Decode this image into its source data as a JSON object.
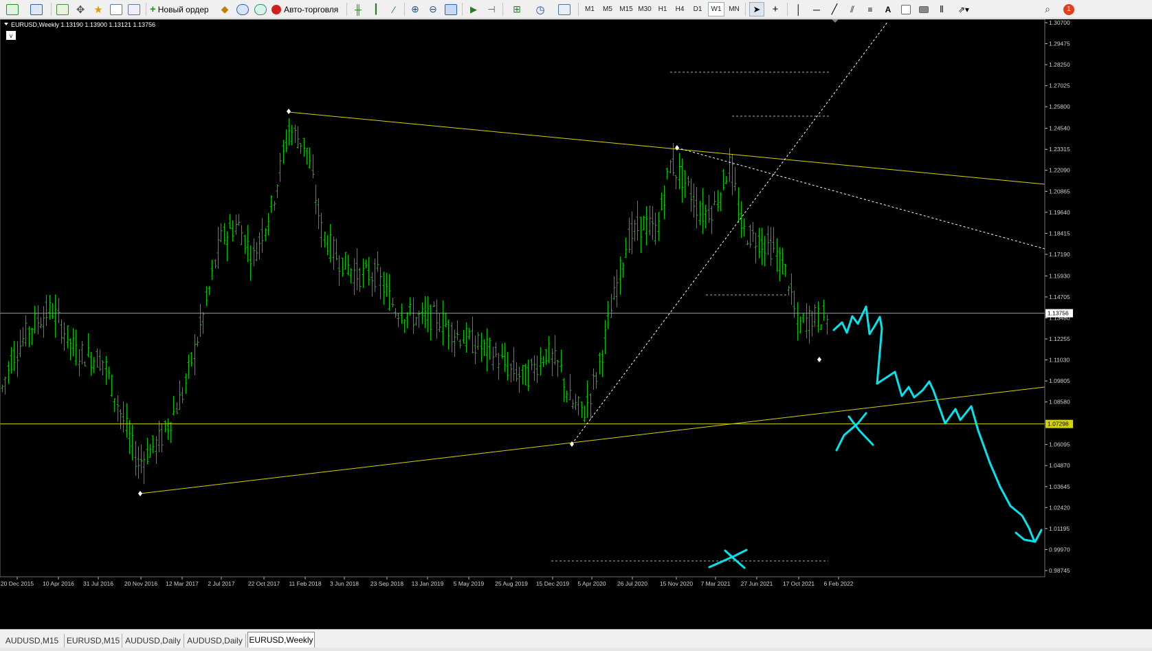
{
  "toolbar": {
    "new_order": "Новый ордер",
    "auto_trading": "Авто-торговля",
    "timeframes": [
      "M1",
      "M5",
      "M15",
      "M30",
      "H1",
      "H4",
      "D1",
      "W1",
      "MN"
    ],
    "active_timeframe": "W1",
    "notification_count": "1"
  },
  "chart": {
    "header": "EURUSD,Weekly  1.13190 1.13900 1.13121 1.13756",
    "collapse_label": "v",
    "bid_label": "1.13756",
    "level_label": "1.07298",
    "background": "#000000",
    "candle_color": "#00c800",
    "line_color": "#d4d400",
    "drawing_color": "#00e5ee"
  },
  "chart_data": {
    "type": "ohlc",
    "symbol": "EURUSD",
    "timeframe": "Weekly",
    "open": 1.1319,
    "high": 1.139,
    "low": 1.13121,
    "close": 1.13756,
    "x_ticks": [
      "20 Dec 2015",
      "10 Apr 2016",
      "31 Jul 2016",
      "20 Nov 2016",
      "12 Mar 2017",
      "2 Jul 2017",
      "22 Oct 2017",
      "11 Feb 2018",
      "3 Jun 2018",
      "23 Sep 2018",
      "13 Jan 2019",
      "5 May 2019",
      "25 Aug 2019",
      "15 Dec 2019",
      "5 Apr 2020",
      "26 Jul 2020",
      "15 Nov 2020",
      "7 Mar 2021",
      "27 Jun 2021",
      "17 Oct 2021",
      "6 Feb 2022"
    ],
    "y_ticks": [
      "1.30700",
      "1.29475",
      "1.28250",
      "1.27025",
      "1.25800",
      "1.24540",
      "1.23315",
      "1.22090",
      "1.20865",
      "1.19640",
      "1.18415",
      "1.17190",
      "1.15930",
      "1.14705",
      "1.13480",
      "1.12255",
      "1.11030",
      "1.09805",
      "1.08580",
      "1.07298",
      "1.06095",
      "1.04870",
      "1.03645",
      "1.02420",
      "1.01195",
      "0.99970",
      "0.98745"
    ],
    "ylim": [
      0.98745,
      1.307
    ],
    "current_price": 1.13756,
    "horizontal_level": 1.07298
  },
  "tabs": [
    "AUDUSD,M15",
    "EURUSD,M15",
    "AUDUSD,Daily",
    "AUDUSD,Daily",
    "EURUSD,Weekly"
  ],
  "active_tab": "EURUSD,Weekly"
}
